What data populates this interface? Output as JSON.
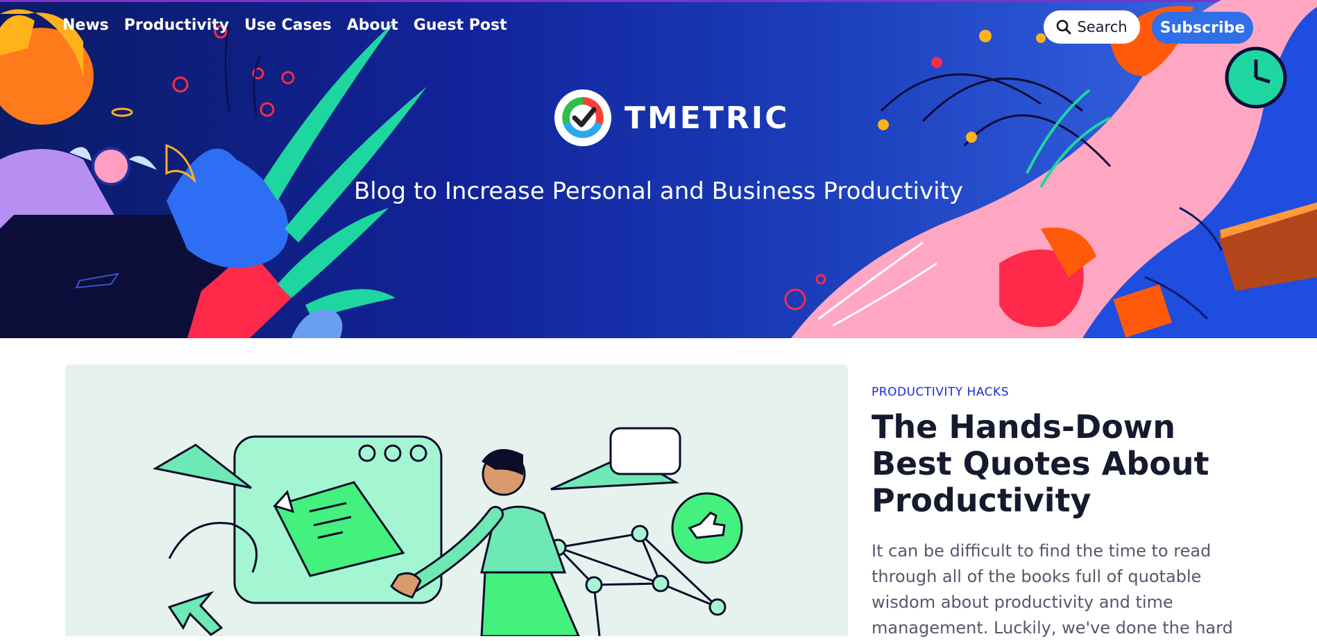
{
  "nav": {
    "items": [
      {
        "label": "News"
      },
      {
        "label": "Productivity"
      },
      {
        "label": "Use Cases"
      },
      {
        "label": "About"
      },
      {
        "label": "Guest Post"
      }
    ]
  },
  "header": {
    "search_label": "Search",
    "subscribe_label": "Subscribe",
    "logo_text": "TMETRIC",
    "tagline": "Blog to Increase Personal and Business Productivity"
  },
  "featured": {
    "category": "PRODUCTIVITY HACKS",
    "title": "The Hands-Down Best Quotes About Productivity",
    "excerpt": "It can be difficult to find the time to read through all of the books full of quotable wisdom about productivity and time management. Luckily, we've done the hard"
  },
  "colors": {
    "hero_bg": "#12239a",
    "subscribe_bg": "#2f6fe8",
    "category_text": "#1b2ad6",
    "title_text": "#161a2e",
    "feature_bg": "#e6f2ed"
  },
  "icons": {
    "search": "search-icon",
    "logo": "tmetric-logo-icon"
  }
}
